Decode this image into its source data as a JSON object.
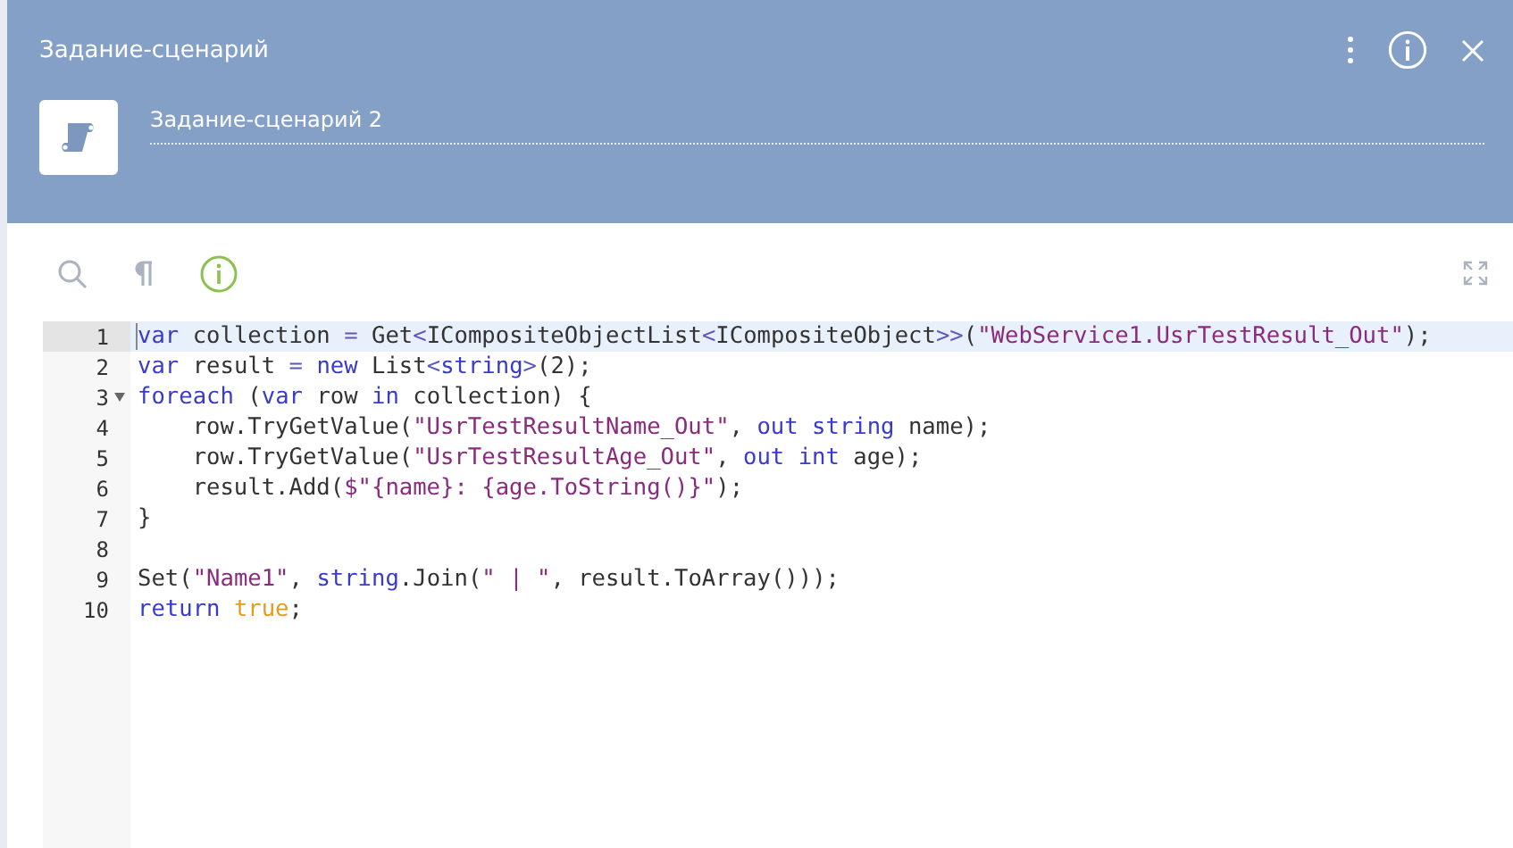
{
  "header": {
    "title": "Задание-сценарий",
    "name_field": {
      "value": "Задание-сценарий 2"
    }
  },
  "editor": {
    "lines": [
      {
        "number": "1",
        "current": true,
        "tokens": [
          {
            "kind": "kw",
            "text": "var"
          },
          {
            "kind": "plain",
            "text": " collection "
          },
          {
            "kind": "op",
            "text": "="
          },
          {
            "kind": "plain",
            "text": " Get"
          },
          {
            "kind": "op",
            "text": "<"
          },
          {
            "kind": "plain",
            "text": "ICompositeObjectList"
          },
          {
            "kind": "op",
            "text": "<"
          },
          {
            "kind": "plain",
            "text": "ICompositeObject"
          },
          {
            "kind": "op",
            "text": ">>"
          },
          {
            "kind": "plain",
            "text": "("
          },
          {
            "kind": "str",
            "text": "\"WebService1.UsrTestResult_Out\""
          },
          {
            "kind": "plain",
            "text": ");"
          }
        ]
      },
      {
        "number": "2",
        "current": false,
        "tokens": [
          {
            "kind": "kw",
            "text": "var"
          },
          {
            "kind": "plain",
            "text": " result "
          },
          {
            "kind": "op",
            "text": "="
          },
          {
            "kind": "kw",
            "text": " new"
          },
          {
            "kind": "plain",
            "text": " List"
          },
          {
            "kind": "op",
            "text": "<"
          },
          {
            "kind": "kw",
            "text": "string"
          },
          {
            "kind": "op",
            "text": ">"
          },
          {
            "kind": "plain",
            "text": "(2);"
          }
        ]
      },
      {
        "number": "3",
        "current": false,
        "fold": {
          "expanded": true
        },
        "tokens": [
          {
            "kind": "kw",
            "text": "foreach"
          },
          {
            "kind": "plain",
            "text": " ("
          },
          {
            "kind": "kw",
            "text": "var"
          },
          {
            "kind": "plain",
            "text": " row "
          },
          {
            "kind": "kw",
            "text": "in"
          },
          {
            "kind": "plain",
            "text": " collection) {"
          }
        ]
      },
      {
        "number": "4",
        "current": false,
        "tokens": [
          {
            "kind": "plain",
            "text": "    row.TryGetValue("
          },
          {
            "kind": "str",
            "text": "\"UsrTestResultName_Out\""
          },
          {
            "kind": "plain",
            "text": ", "
          },
          {
            "kind": "kw",
            "text": "out string"
          },
          {
            "kind": "plain",
            "text": " name);"
          }
        ]
      },
      {
        "number": "5",
        "current": false,
        "tokens": [
          {
            "kind": "plain",
            "text": "    row.TryGetValue("
          },
          {
            "kind": "str",
            "text": "\"UsrTestResultAge_Out\""
          },
          {
            "kind": "plain",
            "text": ", "
          },
          {
            "kind": "kw",
            "text": "out int"
          },
          {
            "kind": "plain",
            "text": " age);"
          }
        ]
      },
      {
        "number": "6",
        "current": false,
        "tokens": [
          {
            "kind": "plain",
            "text": "    result.Add("
          },
          {
            "kind": "str",
            "text": "$\"{name}: {age.ToString()}\""
          },
          {
            "kind": "plain",
            "text": ");"
          }
        ]
      },
      {
        "number": "7",
        "current": false,
        "tokens": [
          {
            "kind": "plain",
            "text": "}"
          }
        ]
      },
      {
        "number": "8",
        "current": false
      },
      {
        "number": "9",
        "current": false,
        "tokens": [
          {
            "kind": "plain",
            "text": "Set("
          },
          {
            "kind": "str",
            "text": "\"Name1\""
          },
          {
            "kind": "plain",
            "text": ", "
          },
          {
            "kind": "kw",
            "text": "string"
          },
          {
            "kind": "plain",
            "text": ".Join("
          },
          {
            "kind": "str",
            "text": "\" | \""
          },
          {
            "kind": "plain",
            "text": ", result.ToArray()));"
          }
        ]
      },
      {
        "number": "10",
        "current": false,
        "tokens": [
          {
            "kind": "kw",
            "text": "return"
          },
          {
            "kind": "bool",
            "text": " true"
          },
          {
            "kind": "plain",
            "text": ";"
          }
        ]
      }
    ]
  }
}
